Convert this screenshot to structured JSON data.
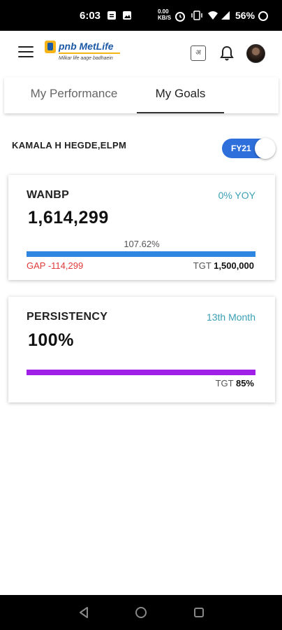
{
  "status_bar": {
    "time": "6:03",
    "icons": [
      "notification-icon",
      "gallery-icon",
      "data-speed-icon",
      "alarm-icon",
      "vibrate-icon",
      "wifi-icon",
      "signal-icon"
    ],
    "data_speed": "0.00",
    "battery": "56%"
  },
  "header": {
    "logo_brand": "pnb MetLife",
    "logo_tagline": "Milkar life aage badhaein",
    "language_label": "अ"
  },
  "tabs": [
    {
      "label": "My Performance",
      "active": false
    },
    {
      "label": "My Goals",
      "active": true
    }
  ],
  "user": {
    "name": "KAMALA H HEGDE,ELPM",
    "fy_label": "FY21"
  },
  "cards": {
    "wanbp": {
      "title": "WANBP",
      "tag": "0% YOY",
      "value": "1,614,299",
      "percent": "107.62%",
      "gap": "GAP -114,299",
      "tgt_label": "TGT",
      "tgt_value": "1,500,000",
      "progress": 1.0,
      "bar_color": "#2f86e0"
    },
    "persistency": {
      "title": "PERSISTENCY",
      "tag": "13th Month",
      "value": "100%",
      "tgt_label": "TGT",
      "tgt_value": "85%",
      "progress": 1.0,
      "bar_color": "#a020e8"
    }
  },
  "colors": {
    "accent": "#2f6fdc",
    "gap_red": "#e03a3a",
    "tag_teal": "#3aa0b5"
  }
}
